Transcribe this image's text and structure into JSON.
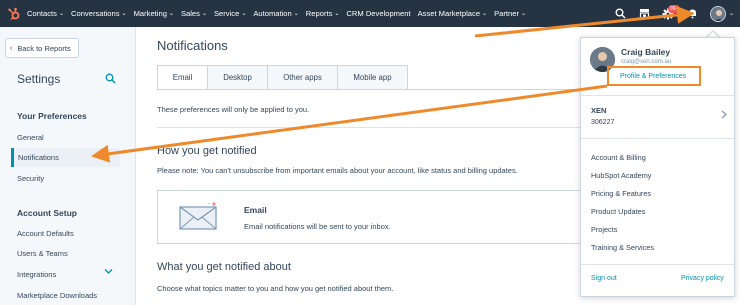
{
  "topnav": {
    "items": [
      {
        "label": "Contacts",
        "caret": true
      },
      {
        "label": "Conversations",
        "caret": true
      },
      {
        "label": "Marketing",
        "caret": true
      },
      {
        "label": "Sales",
        "caret": true
      },
      {
        "label": "Service",
        "caret": true
      },
      {
        "label": "Automation",
        "caret": true
      },
      {
        "label": "Reports",
        "caret": true
      },
      {
        "label": "CRM Development",
        "caret": false
      },
      {
        "label": "Asset Marketplace",
        "caret": true
      },
      {
        "label": "Partner",
        "caret": true
      }
    ],
    "notification_badge": "99+",
    "caret_glyph": "⌄"
  },
  "sidebar": {
    "back_label": "Back to Reports",
    "title": "Settings",
    "your_preferences_heading": "Your Preferences",
    "pref_items": [
      "General",
      "Notifications",
      "Security"
    ],
    "account_setup_heading": "Account Setup",
    "account_items": [
      "Account Defaults",
      "Users & Teams",
      "Integrations",
      "Marketplace Downloads"
    ]
  },
  "main": {
    "title": "Notifications",
    "tabs": [
      "Email",
      "Desktop",
      "Other apps",
      "Mobile app"
    ],
    "pref_note": "These preferences will only be applied to you.",
    "how_heading": "How you get notified",
    "how_note": "Please note: You can't unsubscribe from important emails about your account, like status and billing updates.",
    "email_card_title": "Email",
    "email_card_desc": "Email notifications will be sent to your inbox.",
    "what_heading": "What you get notified about",
    "what_note": "Choose what topics matter to you and how you get notified about them."
  },
  "dropdown": {
    "name": "Craig Bailey",
    "email": "craig@xen.com.au",
    "profile_link": "Profile & Preferences",
    "account_name": "XEN",
    "account_id": "306227",
    "links": [
      "Account & Billing",
      "HubSpot Academy",
      "Pricing & Features",
      "Product Updates",
      "Projects",
      "Training & Services"
    ],
    "sign_out": "Sign out",
    "privacy": "Privacy policy"
  },
  "colors": {
    "nav_bg": "#253342",
    "accent_orange": "#ee8a2c",
    "link_teal": "#0091ae",
    "hubspot_orange": "#ff7a59"
  }
}
